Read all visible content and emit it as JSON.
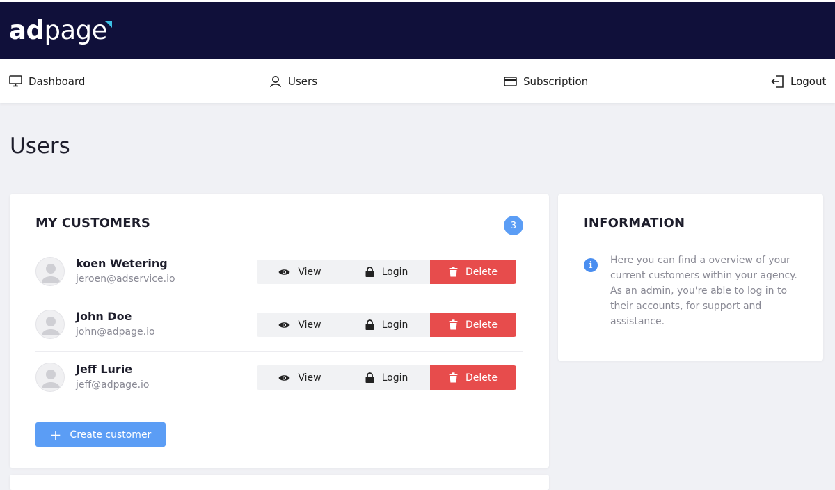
{
  "brand": {
    "logo_bold": "ad",
    "logo_rest": "page"
  },
  "nav": {
    "dashboard": "Dashboard",
    "users": "Users",
    "subscription": "Subscription",
    "logout": "Logout"
  },
  "page": {
    "title": "Users"
  },
  "customers": {
    "title": "MY CUSTOMERS",
    "count": "3",
    "rows": [
      {
        "name": "koen Wetering",
        "email": "jeroen@adservice.io"
      },
      {
        "name": "John Doe",
        "email": "john@adpage.io"
      },
      {
        "name": "Jeff Lurie",
        "email": "jeff@adpage.io"
      }
    ],
    "actions": {
      "view": "View",
      "login": "Login",
      "delete": "Delete"
    },
    "create_label": "Create customer"
  },
  "information": {
    "title": "INFORMATION",
    "text": "Here you can find a overview of your current customers within your agency. As an admin, you're able to log in to their accounts, for support and assistance."
  },
  "colors": {
    "header_bg": "#10103a",
    "accent_blue": "#5b9df5",
    "delete_red": "#e74c4c",
    "logo_mark": "#3cc0e6"
  },
  "icons": {
    "dashboard": "monitor-icon",
    "users": "user-icon",
    "subscription": "credit-card-icon",
    "logout": "logout-icon",
    "view": "eye-icon",
    "login": "lock-icon",
    "delete": "trash-icon",
    "create": "plus-icon",
    "info": "info-icon"
  }
}
